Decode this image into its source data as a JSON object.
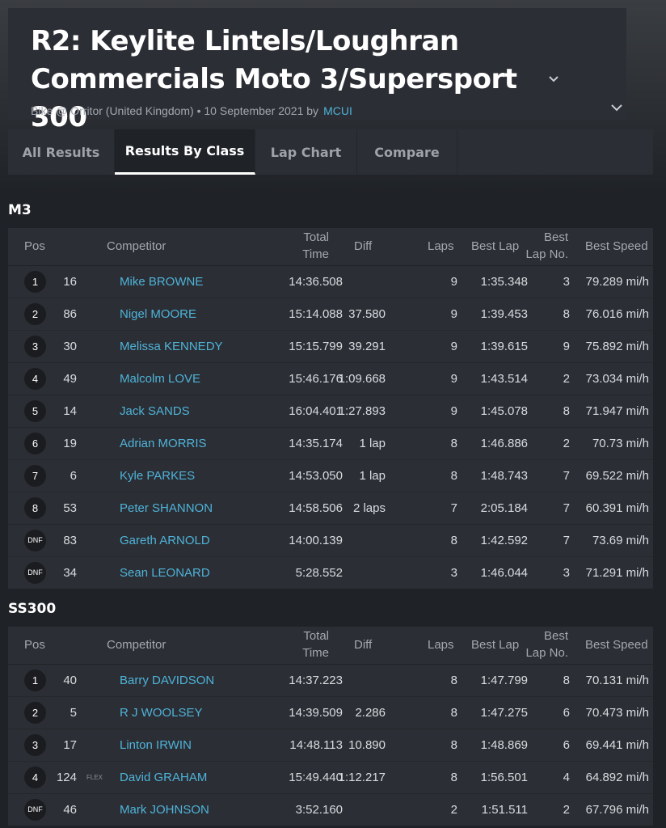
{
  "header": {
    "title": "R2: Keylite Lintels/Loughran Commercials Moto 3/Supersport 300",
    "subtitle_prefix": "Bike @ Orritor (United Kingdom) • 10 September 2021 by",
    "author": "MCUI"
  },
  "tabs": [
    {
      "label": "All Results",
      "active": false
    },
    {
      "label": "Results By Class",
      "active": true
    },
    {
      "label": "Lap Chart",
      "active": false
    },
    {
      "label": "Compare",
      "active": false
    }
  ],
  "columns": {
    "pos": "Pos",
    "competitor": "Competitor",
    "total_time_1": "Total",
    "total_time_2": "Time",
    "diff": "Diff",
    "laps": "Laps",
    "best_lap": "Best Lap",
    "best_lap_no_1": "Best",
    "best_lap_no_2": "Lap No.",
    "best_speed": "Best Speed"
  },
  "classes": [
    {
      "name": "M3",
      "rows": [
        {
          "pos": "1",
          "num": "16",
          "tag": "",
          "name": "Mike BROWNE",
          "time": "14:36.508",
          "diff": "",
          "laps": "9",
          "best_lap": "1:35.348",
          "best_lap_no": "3",
          "speed": "79.289 mi/h"
        },
        {
          "pos": "2",
          "num": "86",
          "tag": "",
          "name": "Nigel MOORE",
          "time": "15:14.088",
          "diff": "37.580",
          "laps": "9",
          "best_lap": "1:39.453",
          "best_lap_no": "8",
          "speed": "76.016 mi/h"
        },
        {
          "pos": "3",
          "num": "30",
          "tag": "",
          "name": "Melissa KENNEDY",
          "time": "15:15.799",
          "diff": "39.291",
          "laps": "9",
          "best_lap": "1:39.615",
          "best_lap_no": "9",
          "speed": "75.892 mi/h"
        },
        {
          "pos": "4",
          "num": "49",
          "tag": "",
          "name": "Malcolm LOVE",
          "time": "15:46.176",
          "diff": "1:09.668",
          "laps": "9",
          "best_lap": "1:43.514",
          "best_lap_no": "2",
          "speed": "73.034 mi/h"
        },
        {
          "pos": "5",
          "num": "14",
          "tag": "",
          "name": "Jack SANDS",
          "time": "16:04.401",
          "diff": "1:27.893",
          "laps": "9",
          "best_lap": "1:45.078",
          "best_lap_no": "8",
          "speed": "71.947 mi/h"
        },
        {
          "pos": "6",
          "num": "19",
          "tag": "",
          "name": "Adrian MORRIS",
          "time": "14:35.174",
          "diff": "1 lap",
          "laps": "8",
          "best_lap": "1:46.886",
          "best_lap_no": "2",
          "speed": "70.73 mi/h"
        },
        {
          "pos": "7",
          "num": "6",
          "tag": "",
          "name": "Kyle PARKES",
          "time": "14:53.050",
          "diff": "1 lap",
          "laps": "8",
          "best_lap": "1:48.743",
          "best_lap_no": "7",
          "speed": "69.522 mi/h"
        },
        {
          "pos": "8",
          "num": "53",
          "tag": "",
          "name": "Peter SHANNON",
          "time": "14:58.506",
          "diff": "2 laps",
          "laps": "7",
          "best_lap": "2:05.184",
          "best_lap_no": "7",
          "speed": "60.391 mi/h"
        },
        {
          "pos": "DNF",
          "num": "83",
          "tag": "",
          "name": "Gareth ARNOLD",
          "time": "14:00.139",
          "diff": "",
          "laps": "8",
          "best_lap": "1:42.592",
          "best_lap_no": "7",
          "speed": "73.69 mi/h"
        },
        {
          "pos": "DNF",
          "num": "34",
          "tag": "",
          "name": "Sean LEONARD",
          "time": "5:28.552",
          "diff": "",
          "laps": "3",
          "best_lap": "1:46.044",
          "best_lap_no": "3",
          "speed": "71.291 mi/h"
        }
      ]
    },
    {
      "name": "SS300",
      "rows": [
        {
          "pos": "1",
          "num": "40",
          "tag": "",
          "name": "Barry DAVIDSON",
          "time": "14:37.223",
          "diff": "",
          "laps": "8",
          "best_lap": "1:47.799",
          "best_lap_no": "8",
          "speed": "70.131 mi/h"
        },
        {
          "pos": "2",
          "num": "5",
          "tag": "",
          "name": "R J WOOLSEY",
          "time": "14:39.509",
          "diff": "2.286",
          "laps": "8",
          "best_lap": "1:47.275",
          "best_lap_no": "6",
          "speed": "70.473 mi/h"
        },
        {
          "pos": "3",
          "num": "17",
          "tag": "",
          "name": "Linton IRWIN",
          "time": "14:48.113",
          "diff": "10.890",
          "laps": "8",
          "best_lap": "1:48.869",
          "best_lap_no": "6",
          "speed": "69.441 mi/h"
        },
        {
          "pos": "4",
          "num": "124",
          "tag": "FLEX",
          "name": "David GRAHAM",
          "time": "15:49.440",
          "diff": "1:12.217",
          "laps": "8",
          "best_lap": "1:56.501",
          "best_lap_no": "4",
          "speed": "64.892 mi/h"
        },
        {
          "pos": "DNF",
          "num": "46",
          "tag": "",
          "name": "Mark JOHNSON",
          "time": "3:52.160",
          "diff": "",
          "laps": "2",
          "best_lap": "1:51.511",
          "best_lap_no": "2",
          "speed": "67.796 mi/h"
        }
      ]
    }
  ]
}
